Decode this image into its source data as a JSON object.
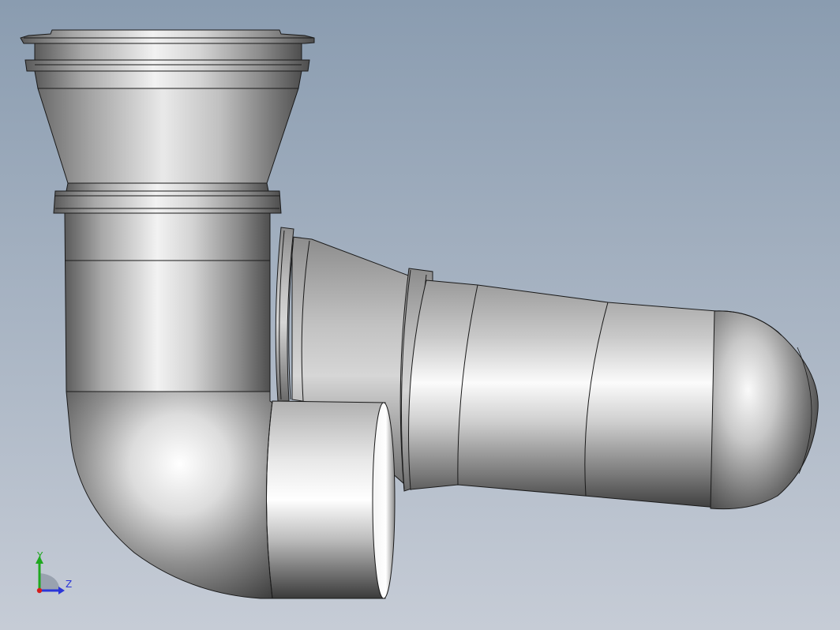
{
  "viewport": {
    "background_top": "#8a9cb0",
    "background_bottom": "#c6ccd6"
  },
  "model": {
    "metal_light": "#ffffff",
    "metal_mid": "#b5b5b5",
    "metal_dark": "#4a4a4a",
    "edge_color": "#1a1a1a"
  },
  "triad": {
    "y_label": "Y",
    "z_label": "Z",
    "y_color": "#1fa81f",
    "z_color": "#2a35d8",
    "x_color": "#d41c1c"
  }
}
